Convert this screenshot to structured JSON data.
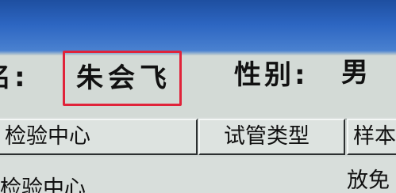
{
  "patient": {
    "name_label": "名:",
    "name_value": "朱会飞",
    "sex_label": "性别:",
    "sex_value": "男"
  },
  "table": {
    "columns": [
      "检验中心",
      "试管类型",
      "样本"
    ],
    "rows": [
      [
        "检验中心",
        "",
        "放免"
      ]
    ]
  },
  "colors": {
    "highlight_box": "#e0233a",
    "title_strip": "#2d66c2",
    "background": "#d3dad6"
  }
}
